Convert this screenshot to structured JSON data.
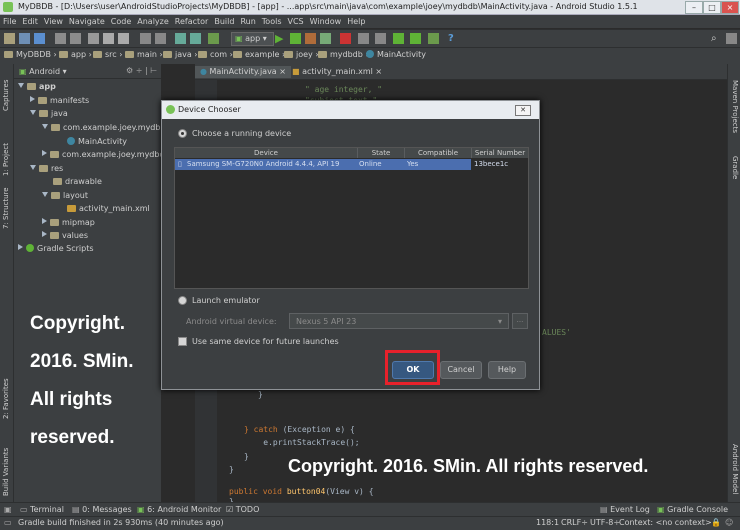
{
  "window": {
    "title": "MyDBDB - [D:\\Users\\user\\AndroidStudioProjects\\MyDBDB] - [app] - ...app\\src\\main\\java\\com\\example\\joey\\mydbdb\\MainActivity.java - Android Studio 1.5.1"
  },
  "menu": [
    "File",
    "Edit",
    "View",
    "Navigate",
    "Code",
    "Analyze",
    "Refactor",
    "Build",
    "Run",
    "Tools",
    "VCS",
    "Window",
    "Help"
  ],
  "toolbar": {
    "run_config": "app"
  },
  "breadcrumbs": [
    "MyDBDB",
    "app",
    "src",
    "main",
    "java",
    "com",
    "example",
    "joey",
    "mydbdb",
    "MainActivity"
  ],
  "project_panel": {
    "view_selector": "Android",
    "tree": [
      {
        "label": "app",
        "level": 0,
        "expanded": true
      },
      {
        "label": "manifests",
        "level": 1,
        "expanded": false
      },
      {
        "label": "java",
        "level": 1,
        "expanded": true
      },
      {
        "label": "com.example.joey.mydbdb",
        "level": 2,
        "expanded": true
      },
      {
        "label": "MainActivity",
        "level": 3
      },
      {
        "label": "com.example.joey.mydbdb",
        "level": 2,
        "expanded": false
      },
      {
        "label": "res",
        "level": 1,
        "expanded": true
      },
      {
        "label": "drawable",
        "level": 2
      },
      {
        "label": "layout",
        "level": 2,
        "expanded": true
      },
      {
        "label": "activity_main.xml",
        "level": 3
      },
      {
        "label": "mipmap",
        "level": 2,
        "expanded": false
      },
      {
        "label": "values",
        "level": 2,
        "expanded": false
      },
      {
        "label": "Gradle Scripts",
        "level": 0,
        "expanded": false
      }
    ]
  },
  "left_tabs": [
    "1: Project",
    "Captures",
    "7: Structure",
    "2: Favorites",
    "Build Variants"
  ],
  "right_tabs": [
    "Maven Projects",
    "Gradle",
    "Android Model"
  ],
  "editor": {
    "tabs": [
      "MainActivity.java",
      "activity_main.xml"
    ],
    "code_top": [
      "\" age integer, \"",
      "\"subject text,\""
    ],
    "code_bottom": [
      "}",
      "} catch (Exception e) {",
      "    e.printStackTrace();",
      "}",
      "}",
      "public void button04(View v) {",
      "}"
    ],
    "code_right_fragment": "ALUES'"
  },
  "dialog": {
    "title": "Device Chooser",
    "running_label": "Choose a running device",
    "table_headers": [
      "Device",
      "State",
      "Compatible",
      "Serial Number"
    ],
    "device_row": {
      "device": "Samsung SM-G720N0 Android 4.4.4, API 19",
      "state": "Online",
      "compatible": "Yes",
      "serial": "13bece1c"
    },
    "emulator_label": "Launch emulator",
    "avd_label": "Android virtual device:",
    "avd_value": "Nexus 5 API 23",
    "avd_more": "...",
    "same_device_label": "Use same device for future launches",
    "ok": "OK",
    "cancel": "Cancel",
    "help": "Help"
  },
  "watermark": {
    "left_lines": [
      "Copyright.",
      "2016. SMin.",
      "All rights",
      "reserved."
    ],
    "bottom": "Copyright. 2016. SMin. All rights reserved."
  },
  "bottom_tools": [
    "Terminal",
    "0: Messages",
    "6: Android Monitor",
    "TODO",
    "Event Log",
    "Gradle Console"
  ],
  "status": {
    "message": "Gradle build finished in 2s 930ms (40 minutes ago)",
    "position": "118:1",
    "line_ending": "CRLF÷",
    "encoding": "UTF-8÷",
    "context": "Context: <no context>"
  },
  "colors": {
    "highlight_box": "#e8212b",
    "selection": "#4b6eaf",
    "ide_bg": "#2b2b2b"
  }
}
